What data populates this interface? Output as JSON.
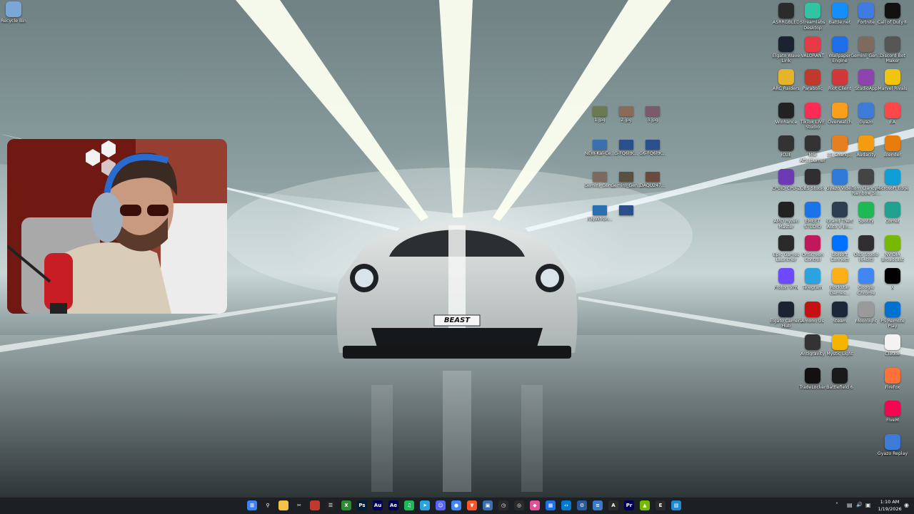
{
  "desktop": {
    "left_icons": [
      {
        "label": "Recycle Bin",
        "icon": "recycle-bin-icon",
        "color": "#7aa7d8"
      }
    ],
    "right_icons": [
      {
        "label": "ASRRGBLED",
        "icon": "asrock-icon",
        "color": "#2b2b2b"
      },
      {
        "label": "Streamlabs Desktop",
        "icon": "streamlabs-icon",
        "color": "#31c3a2"
      },
      {
        "label": "Battle.net",
        "icon": "battlenet-icon",
        "color": "#148eff"
      },
      {
        "label": "Fortnite",
        "icon": "fortnite-icon",
        "color": "#3f7be0"
      },
      {
        "label": "Call of Duty®",
        "icon": "cod-icon",
        "color": "#111111"
      },
      {
        "label": "Elgato Wave Link",
        "icon": "wavelink-icon",
        "color": "#1b2230"
      },
      {
        "label": "VALORANT",
        "icon": "valorant-icon",
        "color": "#e63946"
      },
      {
        "label": "Wallpaper Engine",
        "icon": "wallpaper-engine-icon",
        "color": "#1f6feb"
      },
      {
        "label": "Gemini_Gen...",
        "icon": "image-file-icon",
        "color": "#7d6b60"
      },
      {
        "label": "Discord Bot Maker",
        "icon": "discord-bot-maker-icon",
        "color": "#555555"
      },
      {
        "label": "ARC Raiders",
        "icon": "arc-raiders-icon",
        "color": "#e4b52b"
      },
      {
        "label": "Parabolic",
        "icon": "parabolic-icon",
        "color": "#c0392b"
      },
      {
        "label": "Riot Client",
        "icon": "riot-client-icon",
        "color": "#d13639"
      },
      {
        "label": "StudioApp",
        "icon": "studioapp-icon",
        "color": "#8e44ad"
      },
      {
        "label": "Marvel Rivals",
        "icon": "marvel-rivals-icon",
        "color": "#f1c40f"
      },
      {
        "label": "Winhance",
        "icon": "winhance-icon",
        "color": "#222222"
      },
      {
        "label": "TikTok LIVE Studio",
        "icon": "tiktok-icon",
        "color": "#fe2c55"
      },
      {
        "label": "Overwatch",
        "icon": "overwatch-icon",
        "color": "#f99e1a"
      },
      {
        "label": "Gyazo",
        "icon": "gyazo-icon",
        "color": "#3d7bd9"
      },
      {
        "label": "EA",
        "icon": "ea-icon",
        "color": "#ff4747"
      },
      {
        "label": "iCUE",
        "icon": "icue-icon",
        "color": "#333333"
      },
      {
        "label": "MSI Afterburner",
        "icon": "msi-afterburner-icon",
        "color": "#333333"
      },
      {
        "label": "LG Chang...",
        "icon": "lg-icon",
        "color": "#e67e22"
      },
      {
        "label": "Audacity",
        "icon": "audacity-icon",
        "color": "#f39c12"
      },
      {
        "label": "Blender",
        "icon": "blender-icon",
        "color": "#e87d0d"
      },
      {
        "label": "CPUID CPU-Z",
        "icon": "cpuz-icon",
        "color": "#6c3ab2"
      },
      {
        "label": "OBS Studio",
        "icon": "obs-icon",
        "color": "#302e31"
      },
      {
        "label": "Gyazo Video",
        "icon": "gyazo-video-icon",
        "color": "#2f7ad9"
      },
      {
        "label": "Tom Clancy's Rainbow Si...",
        "icon": "rainbow-six-icon",
        "color": "#444444"
      },
      {
        "label": "Microsoft Edge",
        "icon": "edge-icon",
        "color": "#0f9ed5"
      },
      {
        "label": "AMD Ryzen Master",
        "icon": "amd-icon",
        "color": "#222222"
      },
      {
        "label": "EMEET STUDIO",
        "icon": "emeet-icon",
        "color": "#1a73e8"
      },
      {
        "label": "Grand Theft Auto V En...",
        "icon": "gta-icon",
        "color": "#2c3e50"
      },
      {
        "label": "Spotify",
        "icon": "spotify-icon",
        "color": "#1db954"
      },
      {
        "label": "Comet",
        "icon": "comet-icon",
        "color": "#20a090"
      },
      {
        "label": "Epic Games Launcher",
        "icon": "epic-games-icon",
        "color": "#2a2a2a"
      },
      {
        "label": "OnScreen Control",
        "icon": "onscreen-control-icon",
        "color": "#c2185b"
      },
      {
        "label": "Ubisoft Connect",
        "icon": "ubisoft-icon",
        "color": "#0070ff"
      },
      {
        "label": "OBS Studio (64bit)",
        "icon": "obs-icon",
        "color": "#302e31"
      },
      {
        "label": "NVIDIA Broadcast",
        "icon": "nvidia-icon",
        "color": "#76b900"
      },
      {
        "label": "Proton VPN",
        "icon": "protonvpn-icon",
        "color": "#6d4aff"
      },
      {
        "label": "Telegram",
        "icon": "telegram-icon",
        "color": "#2aa3de"
      },
      {
        "label": "Rockstar Games...",
        "icon": "rockstar-icon",
        "color": "#fcaf17"
      },
      {
        "label": "Google Chrome",
        "icon": "chrome-icon",
        "color": "#4285f4"
      },
      {
        "label": "X",
        "icon": "x-icon",
        "color": "#000000"
      },
      {
        "label": "Elgato Camera Hub",
        "icon": "camera-hub-icon",
        "color": "#1b2230"
      },
      {
        "label": "Among Us",
        "icon": "among-us-icon",
        "color": "#c51111"
      },
      {
        "label": "Steam",
        "icon": "steam-icon",
        "color": "#1b2838"
      },
      {
        "label": "Moonlight",
        "icon": "moonlight-icon",
        "color": "#9a9a9a"
      },
      {
        "label": "PS Remote Play",
        "icon": "ps-remote-play-icon",
        "color": "#0070d1"
      },
      {
        "label": "Antigravity",
        "icon": "antigravity-icon",
        "color": "#333333"
      },
      {
        "label": "Mystic Light",
        "icon": "mystic-light-icon",
        "color": "#f5b400"
      },
      {
        "label": "Claude",
        "icon": "claude-icon",
        "color": "#f3f3f3"
      },
      {
        "label": "TradeLocker",
        "icon": "tradelocker-icon",
        "color": "#111111"
      },
      {
        "label": "Battlefield 6",
        "icon": "battlefield-icon",
        "color": "#1a1a1a"
      },
      {
        "label": "Firefox",
        "icon": "firefox-icon",
        "color": "#ff7139"
      },
      {
        "label": "FiveM",
        "icon": "fivem-icon",
        "color": "#f40552"
      },
      {
        "label": "Gyazo Replay",
        "icon": "gyazo-replay-icon",
        "color": "#3d7bd9"
      }
    ],
    "file_icons": [
      {
        "label": "1.jpg",
        "icon": "image-file-icon",
        "color": "#6b7a4f"
      },
      {
        "label": "2.jpg",
        "icon": "image-file-icon",
        "color": "#8a6b5a"
      },
      {
        "label": "3.jpg",
        "icon": "image-file-icon",
        "color": "#7a5a6b"
      },
      {
        "label": "NEW-Kai-Ce...",
        "icon": "image-file-icon",
        "color": "#3a6fb0"
      },
      {
        "label": "G-FQ6ltK...",
        "icon": "image-file-icon",
        "color": "#2a4f8a"
      },
      {
        "label": "G6-FQ6ltK...",
        "icon": "image-file-icon",
        "color": "#2a4f8a"
      },
      {
        "label": "Gemini_Gen...",
        "icon": "image-file-icon",
        "color": "#7d6b60"
      },
      {
        "label": "Gemini_Gen...",
        "icon": "image-file-icon",
        "color": "#5a5040"
      },
      {
        "label": "DAQU247...",
        "icon": "image-file-icon",
        "color": "#6b4a40"
      },
      {
        "label": "n3yWhGn...",
        "icon": "image-file-icon",
        "color": "#2a6fb0"
      },
      {
        "label": "",
        "icon": "image-file-icon",
        "color": "#2a4f8a"
      }
    ]
  },
  "wallpaper": {
    "plate_text": "BEAST"
  },
  "taskbar": {
    "pinned": [
      {
        "name": "start-button",
        "glyph": "⊞",
        "color": "#3b82f6"
      },
      {
        "name": "search-icon",
        "glyph": "⚲",
        "color": "#1c1f24"
      },
      {
        "name": "file-explorer-icon",
        "glyph": "",
        "color": "#f6c244"
      },
      {
        "name": "snipping-tool-icon",
        "glyph": "✂",
        "color": "#1c1f24"
      },
      {
        "name": "parabolic-icon",
        "glyph": "",
        "color": "#c0392b"
      },
      {
        "name": "capcut-icon",
        "glyph": "☰",
        "color": "#222222"
      },
      {
        "name": "xbox-icon",
        "glyph": "X",
        "color": "#2e8b2e"
      },
      {
        "name": "photoshop-icon",
        "glyph": "Ps",
        "color": "#001e36"
      },
      {
        "name": "audition-icon",
        "glyph": "Au",
        "color": "#00005b"
      },
      {
        "name": "after-effects-icon",
        "glyph": "Ae",
        "color": "#00005b"
      },
      {
        "name": "spotify-icon",
        "glyph": "♫",
        "color": "#1db954"
      },
      {
        "name": "telegram-icon",
        "glyph": "➤",
        "color": "#2aa3de"
      },
      {
        "name": "discord-icon",
        "glyph": "☺",
        "color": "#5865f2"
      },
      {
        "name": "chrome-icon",
        "glyph": "●",
        "color": "#4285f4"
      },
      {
        "name": "brave-icon",
        "glyph": "▼",
        "color": "#fb542b"
      },
      {
        "name": "snip-icon",
        "glyph": "▣",
        "color": "#3a6fb0"
      },
      {
        "name": "clock-app-icon",
        "glyph": "◷",
        "color": "#2a2a2a"
      },
      {
        "name": "controller-icon",
        "glyph": "◎",
        "color": "#2a2a2a"
      },
      {
        "name": "paint-icon",
        "glyph": "◆",
        "color": "#e05297"
      },
      {
        "name": "wallpaper-engine-icon",
        "glyph": "▦",
        "color": "#1f6feb"
      },
      {
        "name": "vscode-icon",
        "glyph": "‹›",
        "color": "#007acc"
      },
      {
        "name": "settings-icon",
        "glyph": "⚙",
        "color": "#2a5a9a"
      },
      {
        "name": "notepad-icon",
        "glyph": "≡",
        "color": "#3a7ac8"
      },
      {
        "name": "antigravity-icon",
        "glyph": "A",
        "color": "#2a2a2a"
      },
      {
        "name": "premiere-icon",
        "glyph": "Pr",
        "color": "#00005b"
      },
      {
        "name": "nvidia-icon",
        "glyph": "▲",
        "color": "#76b900"
      },
      {
        "name": "epic-games-icon",
        "glyph": "E",
        "color": "#2a2a2a"
      },
      {
        "name": "photos-icon",
        "glyph": "▧",
        "color": "#1f8ad2"
      }
    ],
    "tray": {
      "chevron": "˄",
      "icons": [
        "▤",
        "🔊",
        "▣"
      ],
      "time": "1:10 AM",
      "date": "1/19/2026",
      "bell": "◉"
    }
  }
}
